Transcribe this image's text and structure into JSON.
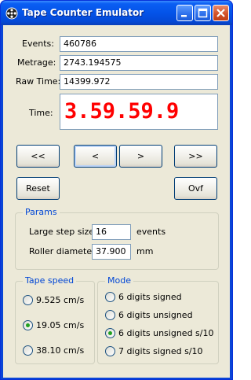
{
  "window": {
    "title": "Tape Counter Emulator"
  },
  "fields": {
    "events_label": "Events:",
    "events_value": "460786",
    "metrage_label": "Metrage:",
    "metrage_value": "2743.194575",
    "rawtime_label": "Raw Time:",
    "rawtime_value": "14399.972",
    "time_label": "Time:",
    "time_value": "3.59.59.9"
  },
  "colors": {
    "time_display": "#ff0000",
    "group_title": "#0046d5",
    "titlebar": "#0453e8"
  },
  "buttons": {
    "fast_rewind": "<<",
    "step_back": "<",
    "step_forward": ">",
    "fast_forward": ">>",
    "reset": "Reset",
    "ovf": "Ovf"
  },
  "params": {
    "title": "Params",
    "large_step_label": "Large step size:",
    "large_step_value": "16",
    "large_step_unit": "events",
    "roller_label": "Roller diameter:",
    "roller_value": "37.900",
    "roller_unit": "mm"
  },
  "tape_speed": {
    "title": "Tape speed",
    "options": [
      "9.525 cm/s",
      "19.05 cm/s",
      "38.10 cm/s"
    ],
    "selected": "19.05 cm/s"
  },
  "mode": {
    "title": "Mode",
    "options": [
      "6 digits signed",
      "6 digits unsigned",
      "6 digits unsigned s/10",
      "7 digits signed s/10"
    ],
    "selected": "6 digits unsigned s/10"
  },
  "icons": {
    "app": "film-reel-icon",
    "minimize": "minimize-icon",
    "maximize": "maximize-icon",
    "close": "close-icon"
  }
}
